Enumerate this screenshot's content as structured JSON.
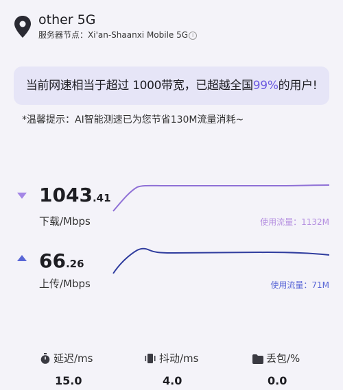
{
  "network": {
    "name": "other 5G",
    "server_label": "服务器节点：",
    "server_value": "Xi'an-Shaanxi Mobile 5G"
  },
  "banner": {
    "prefix": "当前网速相当于超过 1000带宽，已超越全国",
    "percent": "99%",
    "suffix": "的用户!"
  },
  "tip": "*温馨提示：AI智能测速已为您节省130M流量消耗~",
  "download": {
    "value_int": "1043",
    "value_dec": ".41",
    "unit": "下载/Mbps",
    "usage": "使用流量：1132M",
    "color": "#a486e6"
  },
  "upload": {
    "value_int": "66",
    "value_dec": ".26",
    "unit": "上传/Mbps",
    "usage": "使用流量：71M",
    "color": "#5966d6"
  },
  "stats": [
    {
      "label": "延迟/ms",
      "value": "15.0",
      "icon": "stopwatch-icon"
    },
    {
      "label": "抖动/ms",
      "value": "4.0",
      "icon": "vibration-icon"
    },
    {
      "label": "丢包/%",
      "value": "0.0",
      "icon": "folder-icon"
    }
  ]
}
